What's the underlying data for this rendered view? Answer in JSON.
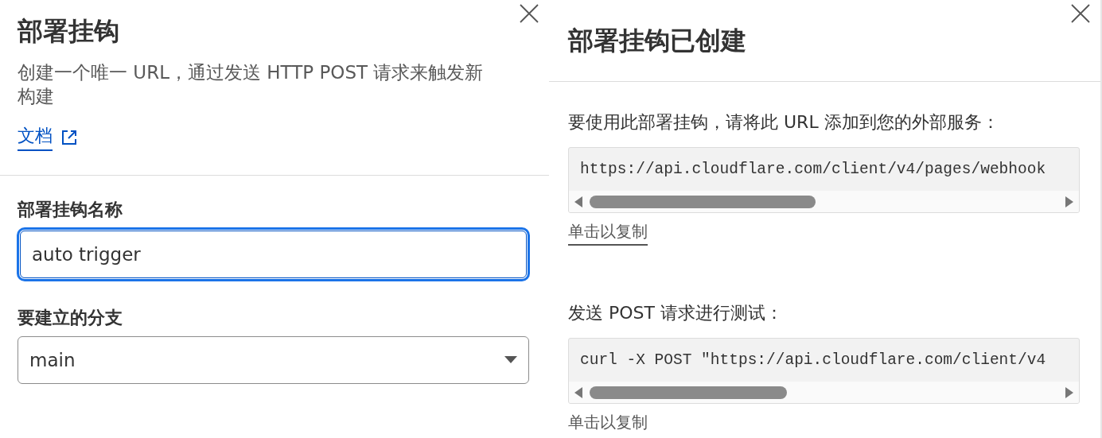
{
  "create_panel": {
    "title": "部署挂钩",
    "description": "创建一个唯一 URL，通过发送 HTTP POST 请求来触发新构建",
    "docs_link": "文档",
    "fields": [
      {
        "kind": "input",
        "label": "部署挂钩名称",
        "value": "auto trigger",
        "focused": true
      },
      {
        "kind": "select",
        "label": "要建立的分支",
        "value": "main",
        "focused": false
      }
    ]
  },
  "created_panel": {
    "title": "部署挂钩已创建",
    "sections": [
      {
        "instruction": "要使用此部署挂钩，请将此 URL 添加到您的外部服务：",
        "code": "https://api.cloudflare.com/client/v4/pages/webhook",
        "copy_link": "单击以复制",
        "underlined": true
      },
      {
        "instruction": "发送 POST 请求进行测试：",
        "code": "curl -X POST \"https://api.cloudflare.com/client/v4",
        "copy_link": "单击以复制",
        "underlined": false
      }
    ]
  }
}
